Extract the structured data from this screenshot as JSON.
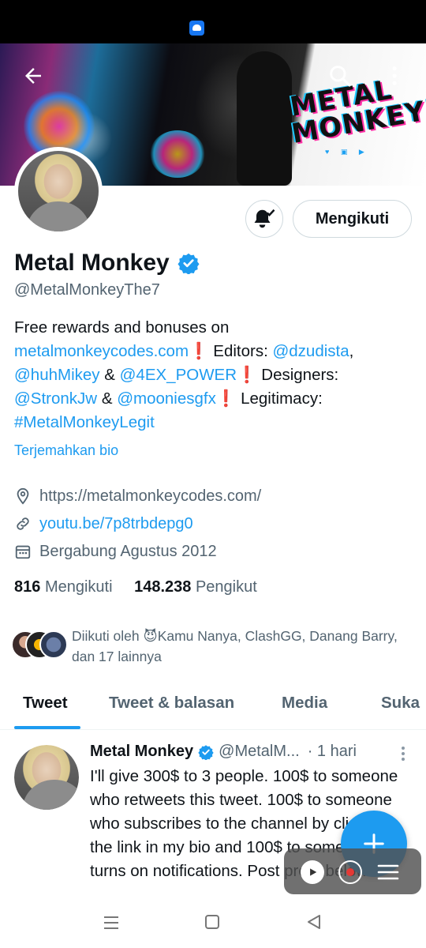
{
  "profile": {
    "name": "Metal Monkey",
    "handle": "@MetalMonkeyThe7",
    "follow_button": "Mengikuti",
    "bio": {
      "line1": "Free rewards and bonuses on",
      "site": "metalmonkeycodes.com",
      "editors_label": " Editors: ",
      "editor1": "@dzudista",
      "comma": ",",
      "editor2": "@huhMikey",
      "amp1": " & ",
      "editor3": "@4EX_POWER",
      "designers_label": " Designers:",
      "designer1": "@StronkJw",
      "amp2": " & ",
      "designer2": "@mooniesgfx",
      "legit_label": " Legitimacy:",
      "hashtag": "#MetalMonkeyLegit",
      "bang": "❗"
    },
    "translate": "Terjemahkan bio",
    "website": "https://metalmonkeycodes.com/",
    "youtube": "youtu.be/7p8trbdepg0",
    "joined": "Bergabung Agustus 2012",
    "following_count": "816",
    "following_label": "Mengikuti",
    "followers_count": "148.238",
    "followers_label": "Pengikut",
    "followed_by": "Diikuti oleh 😈Kamu Nanya, ClashGG, Danang Barry, dan 17 lainnya"
  },
  "banner": {
    "logo_line1": "METAL",
    "logo_line2": "MONKEY!",
    "social": "♥ ▣ ▶"
  },
  "tabs": [
    "Tweet",
    "Tweet & balasan",
    "Media",
    "Suka"
  ],
  "tweet": {
    "name": "Metal Monkey",
    "handle": "@MetalM...",
    "time": "· 1 hari",
    "text": "I'll give 300$ to 3 people. 100$ to someone who retweets this tweet. 100$ to someone who subscribes to the channel by clicking the link in my bio and 100$ to someone who turns on notifications. Post proof below"
  },
  "colors": {
    "accent": "#1d9bf0",
    "text": "#0f1419",
    "muted": "#536471",
    "bang": "#e0245e"
  },
  "icons": [
    "back-arrow-icon",
    "search-icon",
    "more-vertical-icon",
    "bell-check-icon",
    "verified-badge-icon",
    "location-icon",
    "link-icon",
    "calendar-icon",
    "plus-icon",
    "play-icon",
    "record-icon",
    "menu-icon",
    "nav-recents-icon",
    "nav-home-icon",
    "nav-back-icon"
  ]
}
